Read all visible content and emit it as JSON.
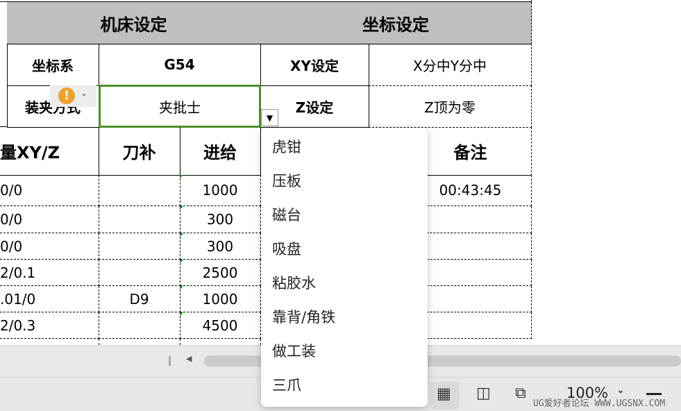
{
  "machine": {
    "title": "机床设定",
    "coord_label": "坐标系",
    "coord_value": "G54",
    "clamp_label": "装夹方式",
    "clamp_value": "夹批士"
  },
  "coordinate": {
    "title": "坐标设定",
    "xy_label": "XY设定",
    "xy_value": "X分中Y分中",
    "z_label": "Z设定",
    "z_value": "Z顶为零"
  },
  "table": {
    "headers": [
      "量XY/Z",
      "刀补",
      "进给",
      "备注"
    ],
    "rows": [
      [
        "0/0",
        "",
        "1000",
        "00:43:45"
      ],
      [
        "0/0",
        "",
        "300",
        ""
      ],
      [
        "0/0",
        "",
        "300",
        ""
      ],
      [
        "2/0.1",
        "",
        "2500",
        ""
      ],
      [
        ".01/0",
        "D9",
        "1000",
        ""
      ],
      [
        "2/0.3",
        "",
        "4500",
        ""
      ]
    ]
  },
  "dropdown": {
    "options": [
      "虎钳",
      "压板",
      "磁台",
      "吸盘",
      "粘胶水",
      "靠背/角铁",
      "做工装",
      "三爪"
    ]
  },
  "status": {
    "zoom": "100%",
    "watermark": "UG爱好者论坛 WWW.UGSNX.COM"
  }
}
